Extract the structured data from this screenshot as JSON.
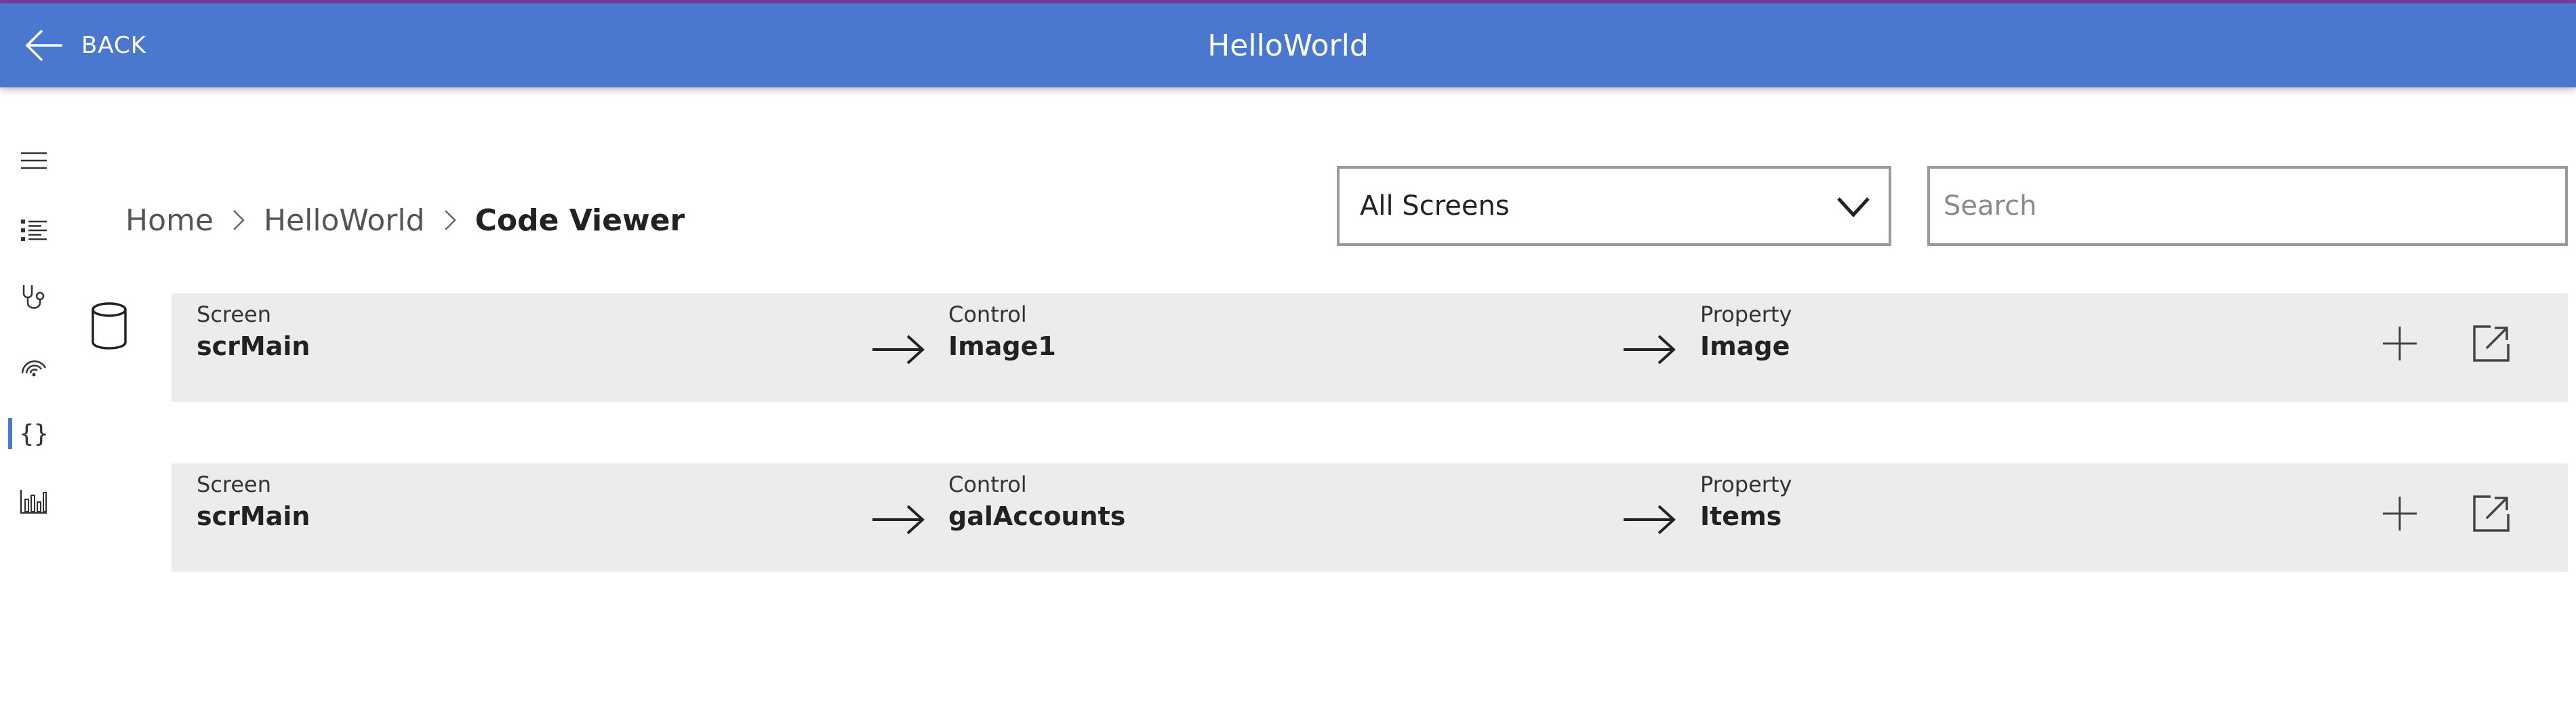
{
  "header": {
    "back_label": "BACK",
    "title": "HelloWorld",
    "bar_color": "#4a78cf"
  },
  "sidebar": {
    "items": [
      {
        "icon": "menu-icon"
      },
      {
        "icon": "list-icon"
      },
      {
        "icon": "stethoscope-icon"
      },
      {
        "icon": "monitor-icon"
      },
      {
        "icon": "code-braces-icon",
        "label": "{}",
        "active": true
      },
      {
        "icon": "bar-chart-icon"
      }
    ]
  },
  "breadcrumb": {
    "items": [
      "Home",
      "HelloWorld"
    ],
    "current": "Code Viewer"
  },
  "filters": {
    "screen_select_value": "All Screens",
    "search_placeholder": "Search"
  },
  "rows": [
    {
      "screen_label": "Screen",
      "screen": "scrMain",
      "control_label": "Control",
      "control": "Image1",
      "property_label": "Property",
      "property": "Image"
    },
    {
      "screen_label": "Screen",
      "screen": "scrMain",
      "control_label": "Control",
      "control": "galAccounts",
      "property_label": "Property",
      "property": "Items"
    }
  ]
}
